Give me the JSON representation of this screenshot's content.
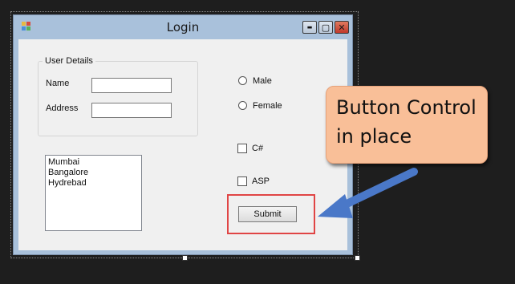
{
  "window": {
    "title": "Login",
    "buttons": {
      "minimize": "▬",
      "maximize": "▢",
      "close": "✕"
    }
  },
  "form": {
    "group_title": "User Details",
    "name_label": "Name",
    "name_value": "",
    "address_label": "Address",
    "address_value": "",
    "cities": [
      "Mumbai",
      "Bangalore",
      "Hydrebad"
    ],
    "gender_options": [
      "Male",
      "Female"
    ],
    "course_options": [
      "C#",
      "ASP"
    ],
    "submit_label": "Submit"
  },
  "callout": {
    "line1": "Button Control",
    "line2": "in place"
  },
  "colors": {
    "highlight": "#e04545",
    "callout_fill": "#f9bf98",
    "arrow": "#4a78c8",
    "titlebar": "#a9c1db"
  },
  "icons": [
    "app-icon",
    "minimize-icon",
    "maximize-icon",
    "close-icon",
    "arrow-icon"
  ]
}
